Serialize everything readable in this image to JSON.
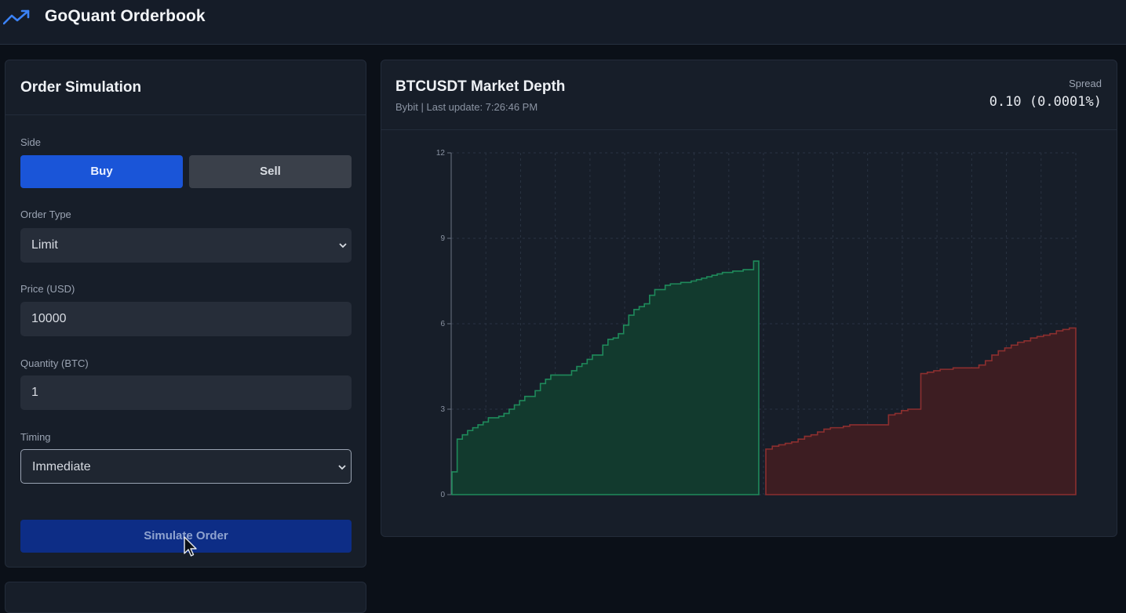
{
  "app": {
    "title": "GoQuant Orderbook",
    "logo_icon": "trending-up-icon"
  },
  "order_form": {
    "title": "Order Simulation",
    "side_label": "Side",
    "buy_label": "Buy",
    "sell_label": "Sell",
    "selected_side": "Buy",
    "order_type_label": "Order Type",
    "order_type_value": "Limit",
    "price_label": "Price (USD)",
    "price_value": "10000",
    "quantity_label": "Quantity (BTC)",
    "quantity_value": "1",
    "timing_label": "Timing",
    "timing_value": "Immediate",
    "submit_label": "Simulate Order"
  },
  "depth": {
    "title": "BTCUSDT Market Depth",
    "subtitle": "Bybit | Last update: 7:26:46 PM",
    "spread_label": "Spread",
    "spread_value": "0.10 (0.0001%)"
  },
  "colors": {
    "accent": "#1a55d8",
    "bid_line": "#1f8a5b",
    "bid_fill": "#123a2e",
    "ask_line": "#8c2f2f",
    "ask_fill": "#3d1d22"
  },
  "chart_data": {
    "type": "area",
    "title": "",
    "xlabel": "",
    "ylabel": "",
    "ylim": [
      0,
      12
    ],
    "yticks": [
      "0",
      "3",
      "6",
      "9",
      "12"
    ],
    "grid": true,
    "series": [
      {
        "side": "bid",
        "values": [
          0.8,
          1.95,
          2.1,
          2.25,
          2.35,
          2.45,
          2.55,
          2.7,
          2.7,
          2.75,
          2.85,
          3.0,
          3.15,
          3.3,
          3.45,
          3.45,
          3.65,
          3.9,
          4.05,
          4.2,
          4.2,
          4.2,
          4.2,
          4.35,
          4.5,
          4.6,
          4.75,
          4.9,
          4.9,
          5.25,
          5.45,
          5.5,
          5.65,
          5.95,
          6.3,
          6.5,
          6.6,
          6.7,
          7.0,
          7.2,
          7.2,
          7.35,
          7.4,
          7.4,
          7.45,
          7.45,
          7.5,
          7.55,
          7.6,
          7.65,
          7.7,
          7.75,
          7.8,
          7.8,
          7.85,
          7.85,
          7.9,
          7.9,
          8.2
        ]
      },
      {
        "side": "ask",
        "values": [
          1.6,
          1.7,
          1.75,
          1.8,
          1.85,
          1.95,
          2.05,
          2.1,
          2.2,
          2.3,
          2.35,
          2.35,
          2.4,
          2.45,
          2.45,
          2.45,
          2.45,
          2.45,
          2.45,
          2.8,
          2.85,
          2.95,
          3.0,
          3.0,
          4.25,
          4.3,
          4.35,
          4.4,
          4.4,
          4.45,
          4.45,
          4.45,
          4.45,
          4.55,
          4.7,
          4.9,
          5.05,
          5.15,
          5.25,
          5.35,
          5.4,
          5.5,
          5.55,
          5.6,
          5.65,
          5.75,
          5.8,
          5.85
        ]
      }
    ]
  }
}
